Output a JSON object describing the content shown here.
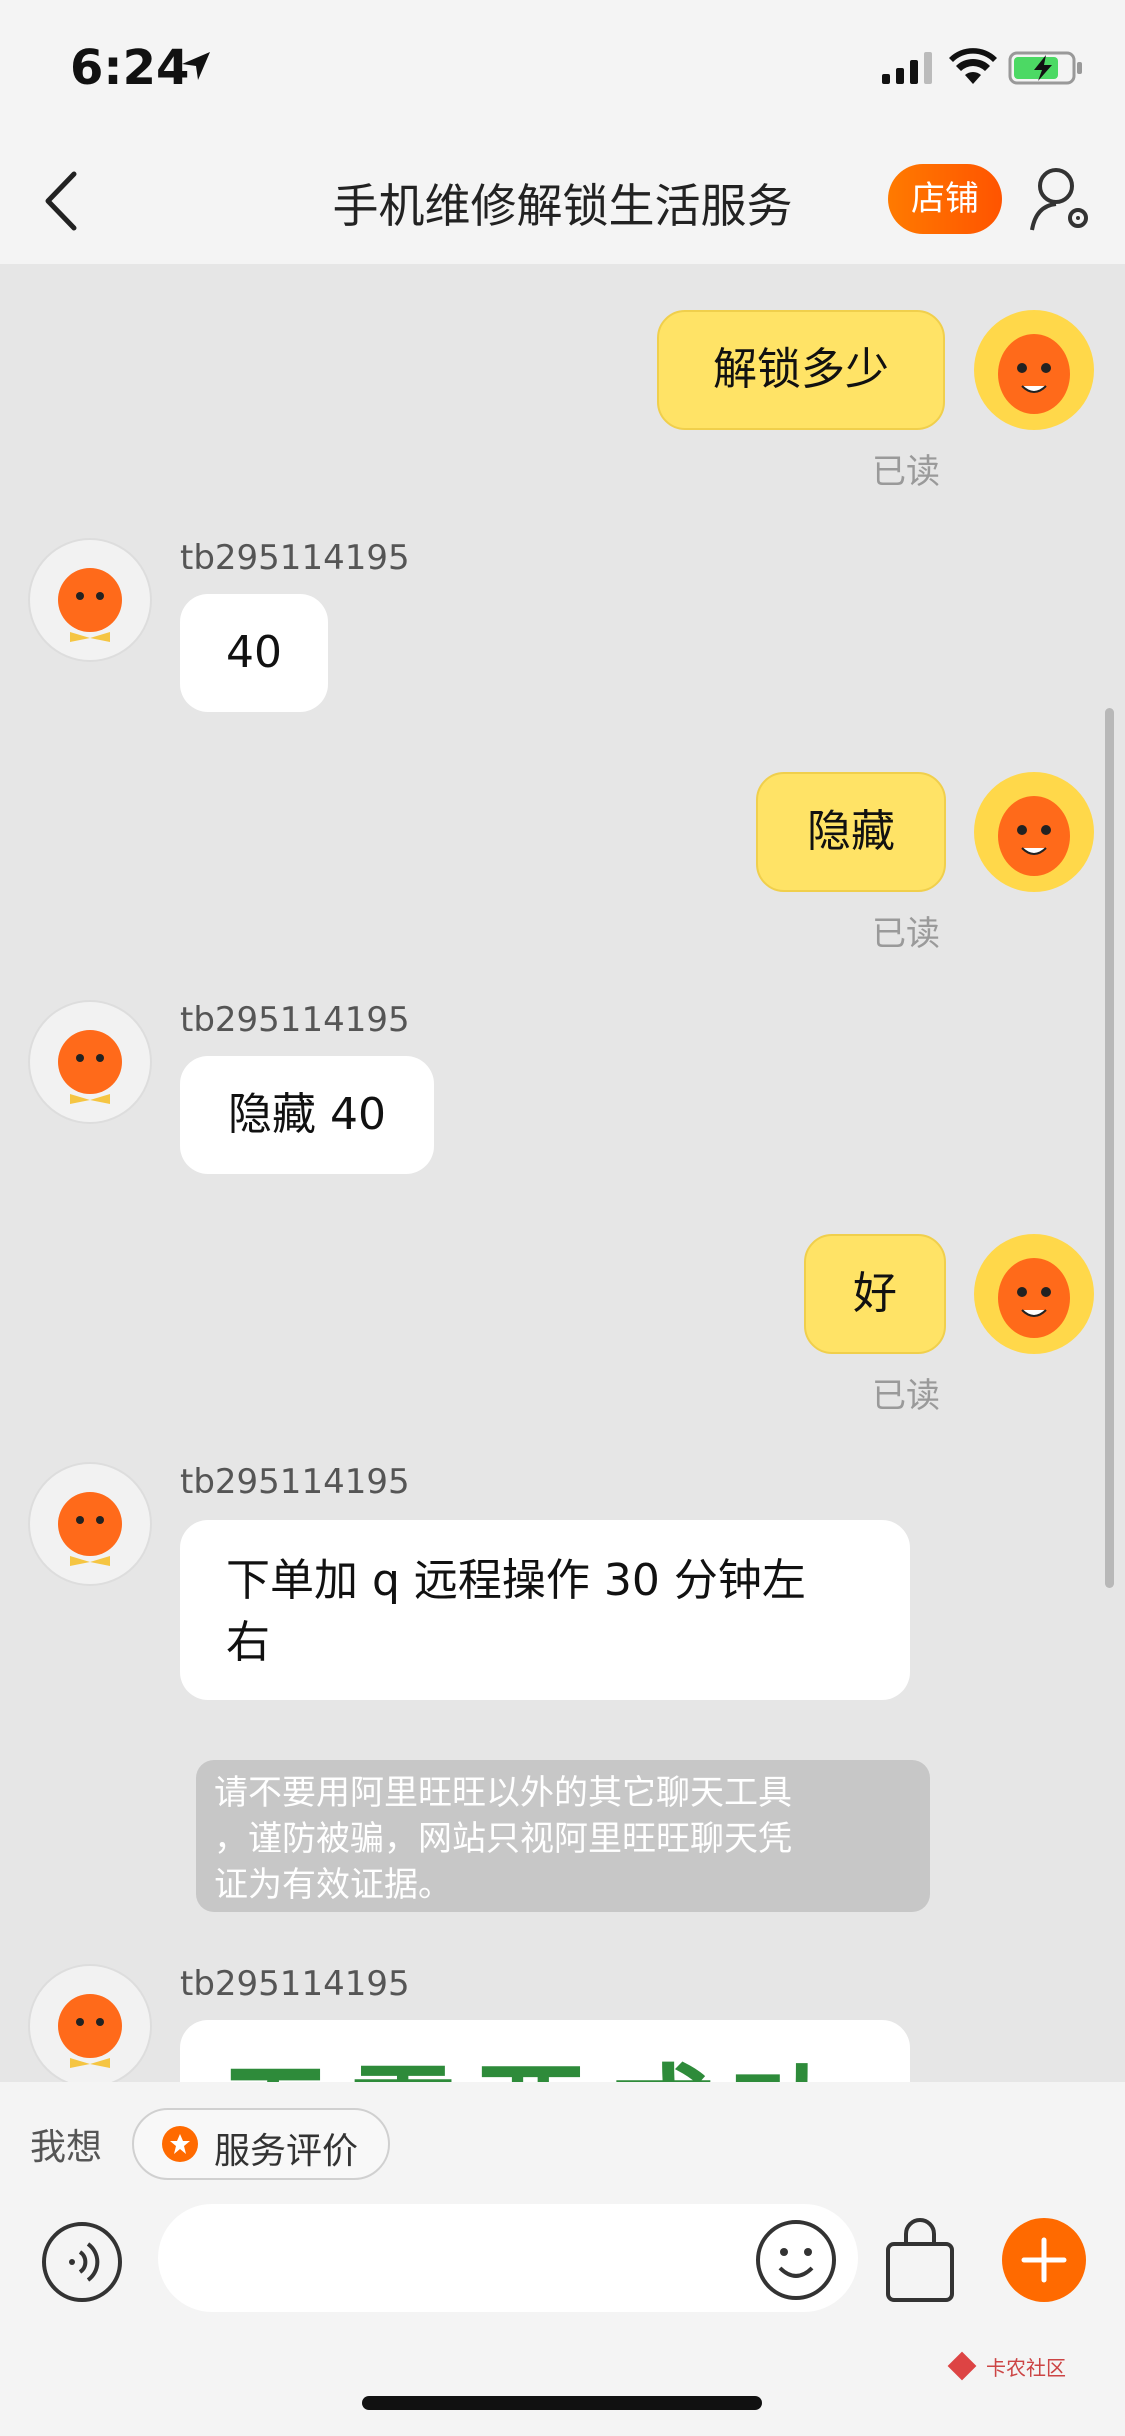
{
  "status": {
    "time": "6:24"
  },
  "nav": {
    "title": "手机维修解锁生活服务",
    "store_label": "店铺"
  },
  "messages": [
    {
      "side": "right",
      "text": "解锁多少",
      "read": "已读"
    },
    {
      "side": "left",
      "sender": "tb295114195",
      "text": "40"
    },
    {
      "side": "right",
      "text": "隐藏",
      "read": "已读"
    },
    {
      "side": "left",
      "sender": "tb295114195",
      "text": "隐藏 40"
    },
    {
      "side": "right",
      "text": "好",
      "read": "已读"
    },
    {
      "side": "left",
      "sender": "tb295114195",
      "text_line1": "下单加 q 远程操作 30 分钟左",
      "text_line2": "右"
    },
    {
      "side": "left",
      "sender": "tb295114195",
      "text": "无需要成功"
    }
  ],
  "notice": {
    "line1": "请不要用阿里旺旺以外的其它聊天工具",
    "line2": "，谨防被骗，网站只视阿里旺旺聊天凭",
    "line3": "证为有效证据。"
  },
  "suggest": {
    "label": "我想",
    "chip_label": "服务评价"
  },
  "input": {
    "placeholder": ""
  },
  "watermark": {
    "text": "卡农社区"
  },
  "colors": {
    "accent": "#ff6a00",
    "bubble_right": "#ffe366",
    "bubble_left": "#ffffff"
  }
}
